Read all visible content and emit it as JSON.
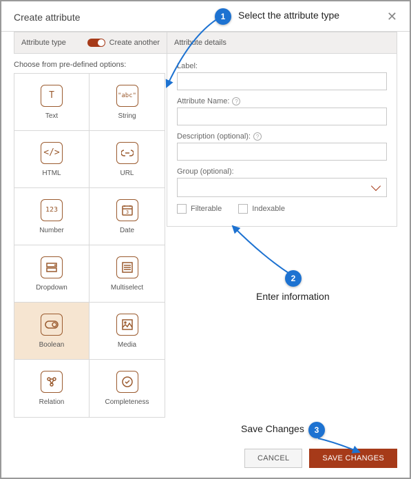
{
  "dialog": {
    "title": "Create attribute"
  },
  "left": {
    "section_label": "Attribute type",
    "toggle_label": "Create another",
    "choose_label": "Choose from pre-defined options:",
    "tiles": [
      {
        "label": "Text"
      },
      {
        "label": "String"
      },
      {
        "label": "HTML"
      },
      {
        "label": "URL"
      },
      {
        "label": "Number"
      },
      {
        "label": "Date"
      },
      {
        "label": "Dropdown"
      },
      {
        "label": "Multiselect"
      },
      {
        "label": "Boolean"
      },
      {
        "label": "Media"
      },
      {
        "label": "Relation"
      },
      {
        "label": "Completeness"
      }
    ]
  },
  "right": {
    "section_label": "Attribute details",
    "label_field": "Label:",
    "name_field": "Attribute Name:",
    "desc_field": "Description (optional):",
    "group_field": "Group (optional):",
    "filterable": "Filterable",
    "indexable": "Indexable"
  },
  "footer": {
    "cancel": "CANCEL",
    "save": "SAVE CHANGES"
  },
  "annotations": {
    "step1_num": "1",
    "step1_text": "Select the attribute type",
    "step2_num": "2",
    "step2_text": "Enter information",
    "step3_num": "3",
    "step3_text": "Save Changes"
  }
}
